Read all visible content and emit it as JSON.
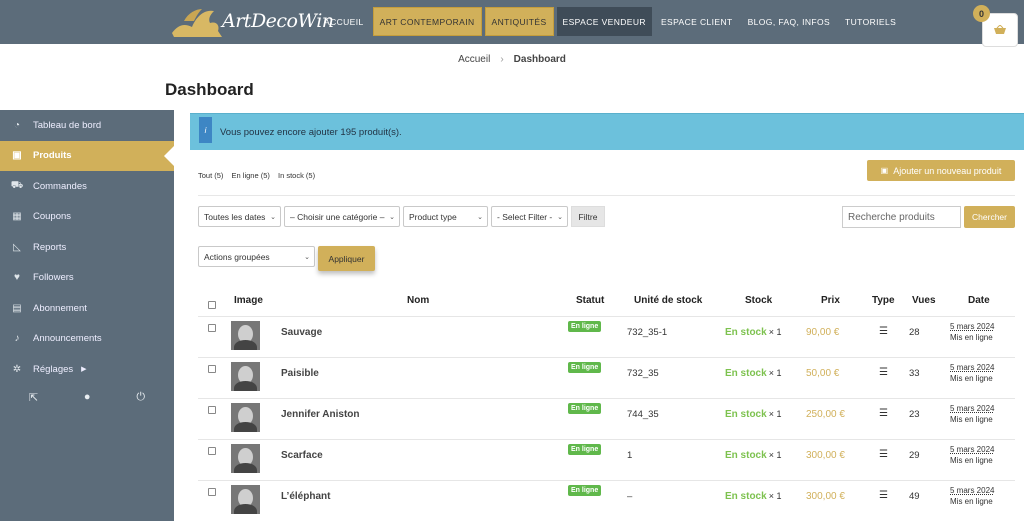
{
  "header": {
    "logo_text": "ArtDecoWin",
    "nav": [
      {
        "label": "ACCUEIL",
        "style": "plain"
      },
      {
        "label": "ART CONTEMPORAIN",
        "style": "gold"
      },
      {
        "label": "ANTIQUITÉS",
        "style": "gold"
      },
      {
        "label": "ESPACE VENDEUR",
        "style": "dark"
      },
      {
        "label": "ESPACE CLIENT",
        "style": "plain"
      },
      {
        "label": "BLOG, FAQ, INFOS",
        "style": "plain"
      },
      {
        "label": "TUTORIELS",
        "style": "plain"
      }
    ],
    "cart_count": "0",
    "cart_icon": "basket-icon"
  },
  "breadcrumb": {
    "home": "Accueil",
    "current": "Dashboard"
  },
  "page_title": "Dashboard",
  "sidebar": {
    "items": [
      {
        "label": "Tableau de bord",
        "icon": "gauge-icon"
      },
      {
        "label": "Produits",
        "icon": "briefcase-icon",
        "active": true
      },
      {
        "label": "Commandes",
        "icon": "cart-icon"
      },
      {
        "label": "Coupons",
        "icon": "gift-icon"
      },
      {
        "label": "Reports",
        "icon": "chart-icon"
      },
      {
        "label": "Followers",
        "icon": "heart-icon"
      },
      {
        "label": "Abonnement",
        "icon": "book-icon"
      },
      {
        "label": "Announcements",
        "icon": "bell-icon"
      },
      {
        "label": "Réglages",
        "icon": "gear-icon",
        "has_arrow": true
      }
    ]
  },
  "alert": {
    "icon_glyph": "i",
    "text": "Vous pouvez encore ajouter 195 produit(s)."
  },
  "filter_links": {
    "all": "Tout (5)",
    "online": "En ligne (5)",
    "in_stock": "In stock (5)"
  },
  "add_product_label": "Ajouter un nouveau produit",
  "filters": {
    "dates": "Toutes les dates",
    "category": "– Choisir une catégorie –",
    "product_type": "Product type",
    "select_filter": "- Select Filter -",
    "filter_button": "Filtre",
    "search_placeholder": "Recherche produits",
    "search_button": "Chercher"
  },
  "bulk": {
    "actions": "Actions groupées",
    "apply": "Appliquer"
  },
  "columns": {
    "image": "Image",
    "name": "Nom",
    "status": "Statut",
    "sku": "Unité de stock",
    "stock": "Stock",
    "price": "Prix",
    "type": "Type",
    "views": "Vues",
    "date": "Date"
  },
  "products": [
    {
      "name": "Sauvage",
      "status": "En ligne",
      "sku": "732_35-1",
      "stock": "En stock",
      "qty": "× 1",
      "price": "90,00 €",
      "views": "28",
      "date": "5 mars 2024",
      "published": "Mis en ligne"
    },
    {
      "name": "Paisible",
      "status": "En ligne",
      "sku": "732_35",
      "stock": "En stock",
      "qty": "× 1",
      "price": "50,00 €",
      "views": "33",
      "date": "5 mars 2024",
      "published": "Mis en ligne"
    },
    {
      "name": "Jennifer Aniston",
      "status": "En ligne",
      "sku": "744_35",
      "stock": "En stock",
      "qty": "× 1",
      "price": "250,00 €",
      "views": "23",
      "date": "5 mars 2024",
      "published": "Mis en ligne"
    },
    {
      "name": "Scarface",
      "status": "En ligne",
      "sku": "1",
      "stock": "En stock",
      "qty": "× 1",
      "price": "300,00 €",
      "views": "29",
      "date": "5 mars 2024",
      "published": "Mis en ligne"
    },
    {
      "name": "L’éléphant",
      "status": "En ligne",
      "sku": "–",
      "stock": "En stock",
      "qty": "× 1",
      "price": "300,00 €",
      "views": "49",
      "date": "5 mars 2024",
      "published": "Mis en ligne"
    }
  ],
  "colors": {
    "gold": "#d1b05a",
    "slate": "#5c6c7a",
    "info": "#6cc1dc",
    "success": "#60b84b"
  }
}
